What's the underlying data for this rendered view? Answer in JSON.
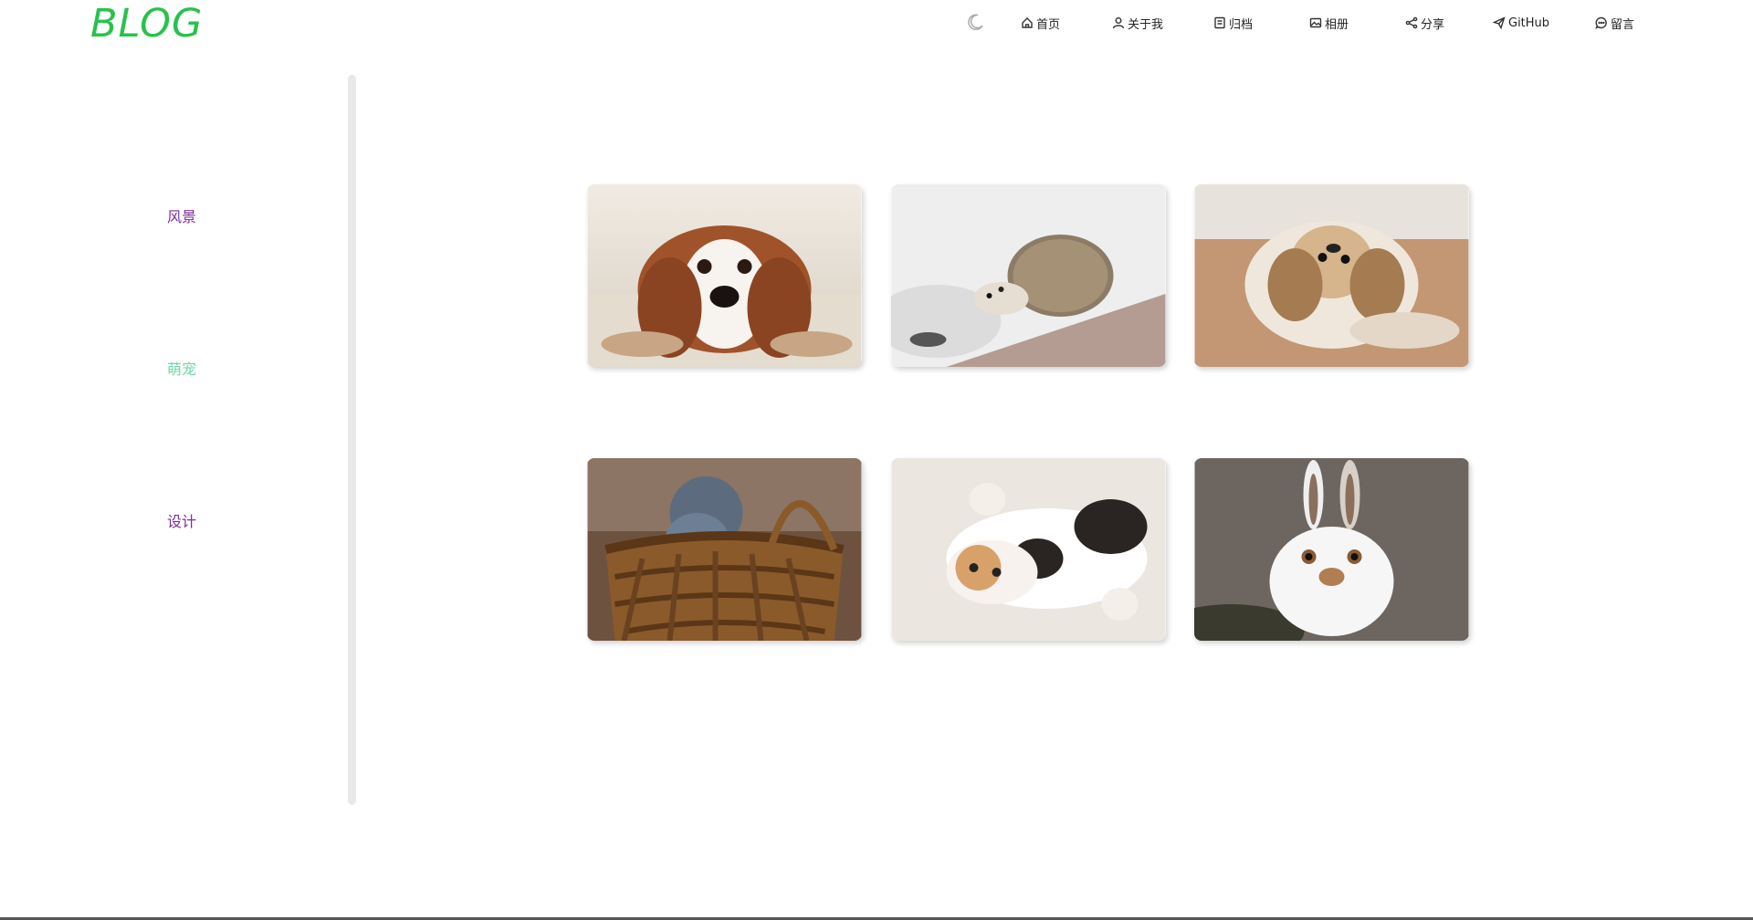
{
  "header": {
    "logo": "BLOG",
    "theme_icon": "moon-icon",
    "nav": [
      {
        "label": "首页",
        "icon": "home-icon"
      },
      {
        "label": "关于我",
        "icon": "user-icon"
      },
      {
        "label": "归档",
        "icon": "archive-icon"
      },
      {
        "label": "相册",
        "icon": "image-icon"
      },
      {
        "label": "分享",
        "icon": "share-icon"
      },
      {
        "label": "GitHub",
        "icon": "send-icon"
      },
      {
        "label": "留言",
        "icon": "chat-icon"
      }
    ]
  },
  "sidebar": {
    "items": [
      {
        "label": "风景",
        "color": "#7a2f9a"
      },
      {
        "label": "萌宠",
        "color": "#6fd6a8"
      },
      {
        "label": "设计",
        "color": "#7a2f9a"
      }
    ]
  },
  "gallery": {
    "photos": [
      {
        "subject": "dog"
      },
      {
        "subject": "hedgehog"
      },
      {
        "subject": "fluffy-dog"
      },
      {
        "subject": "kitten-basket"
      },
      {
        "subject": "cat"
      },
      {
        "subject": "rabbit"
      }
    ]
  },
  "colors": {
    "logo": "#27c24c",
    "active_menu": "#6fd6a8",
    "menu": "#7a2f9a"
  }
}
